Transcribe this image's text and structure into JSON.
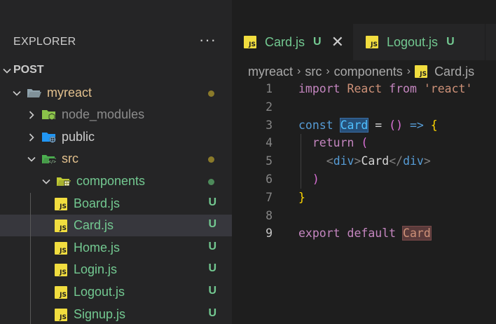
{
  "sidebar": {
    "title": "EXPLORER",
    "more": "···",
    "tree": [
      {
        "label": "POST",
        "type": "root",
        "expanded": true,
        "status": ""
      },
      {
        "label": "myreact",
        "type": "folder",
        "expanded": true,
        "status": "dot",
        "dot_color": "#8a7a2a",
        "label_color": "#e2c08d"
      },
      {
        "label": "node_modules",
        "type": "folder",
        "expanded": false,
        "status": "",
        "label_color": "#8c8c8c",
        "icon": "node-folder-icon"
      },
      {
        "label": "public",
        "type": "folder",
        "expanded": false,
        "status": "",
        "label_color": "#cccccc",
        "icon": "public-folder-icon"
      },
      {
        "label": "src",
        "type": "folder",
        "expanded": true,
        "status": "dot",
        "dot_color": "#8a7a2a",
        "label_color": "#e2c08d",
        "icon": "src-folder-icon"
      },
      {
        "label": "components",
        "type": "folder",
        "expanded": true,
        "status": "dot",
        "dot_color": "#4d8a5a",
        "label_color": "#73c991",
        "icon": "components-folder-icon"
      },
      {
        "label": "Board.js",
        "type": "file",
        "status": "U",
        "label_color": "#73c991"
      },
      {
        "label": "Card.js",
        "type": "file",
        "status": "U",
        "label_color": "#73c991",
        "selected": true
      },
      {
        "label": "Home.js",
        "type": "file",
        "status": "U",
        "label_color": "#73c991"
      },
      {
        "label": "Login.js",
        "type": "file",
        "status": "U",
        "label_color": "#73c991"
      },
      {
        "label": "Logout.js",
        "type": "file",
        "status": "U",
        "label_color": "#73c991"
      },
      {
        "label": "Signup.js",
        "type": "file",
        "status": "U",
        "label_color": "#73c991"
      }
    ]
  },
  "tabs": [
    {
      "label": "Card.js",
      "status": "U",
      "active": true,
      "close": "✕"
    },
    {
      "label": "Logout.js",
      "status": "U",
      "active": false
    }
  ],
  "file_icon_text": "JS",
  "breadcrumb": [
    "myreact",
    "src",
    "components",
    "Card.js"
  ],
  "breadcrumb_sep": "›",
  "code": {
    "current_line": 9,
    "lines": [
      {
        "n": "1",
        "tokens": [
          [
            "kw",
            "import"
          ],
          [
            "plain",
            " "
          ],
          [
            "kw2a",
            "React"
          ],
          [
            "plain",
            " "
          ],
          [
            "kw",
            "from"
          ],
          [
            "plain",
            " "
          ],
          [
            "str",
            "'react'"
          ]
        ]
      },
      {
        "n": "2",
        "tokens": []
      },
      {
        "n": "3",
        "tokens": [
          [
            "kw2",
            "const"
          ],
          [
            "plain",
            " "
          ],
          [
            "identsel",
            "Card"
          ],
          [
            "plain",
            " "
          ],
          [
            "plain",
            "="
          ],
          [
            "plain",
            " "
          ],
          [
            "br2",
            "()"
          ],
          [
            "plain",
            " "
          ],
          [
            "kw2",
            "=>"
          ],
          [
            "plain",
            " "
          ],
          [
            "br1",
            "{"
          ]
        ]
      },
      {
        "n": "4",
        "tokens": [
          [
            "plain",
            "  "
          ],
          [
            "kw",
            "return"
          ],
          [
            "plain",
            " "
          ],
          [
            "br2",
            "("
          ]
        ]
      },
      {
        "n": "5",
        "tokens": [
          [
            "plain",
            "    "
          ],
          [
            "tagbr",
            "<"
          ],
          [
            "tag",
            "div"
          ],
          [
            "tagbr",
            ">"
          ],
          [
            "plain",
            "Card"
          ],
          [
            "tagbr",
            "</"
          ],
          [
            "tag",
            "div"
          ],
          [
            "tagbr",
            ">"
          ]
        ]
      },
      {
        "n": "6",
        "tokens": [
          [
            "plain",
            "  "
          ],
          [
            "br2",
            ")"
          ]
        ]
      },
      {
        "n": "7",
        "tokens": [
          [
            "br1",
            "}"
          ]
        ]
      },
      {
        "n": "8",
        "tokens": []
      },
      {
        "n": "9",
        "tokens": [
          [
            "kw",
            "export"
          ],
          [
            "plain",
            " "
          ],
          [
            "kw",
            "default"
          ],
          [
            "plain",
            " "
          ],
          [
            "identword",
            "Card"
          ]
        ]
      }
    ]
  }
}
